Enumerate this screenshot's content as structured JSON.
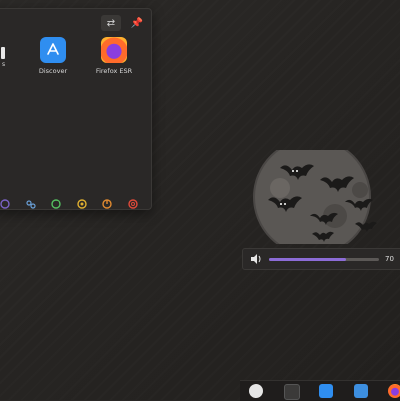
{
  "launcher": {
    "cut_app_label": "s",
    "apps": [
      {
        "label": "Discover",
        "icon": "discover-icon"
      },
      {
        "label": "Firefox ESR",
        "icon": "firefox-icon"
      }
    ],
    "header_icons": [
      "config-icon",
      "pin-icon"
    ],
    "session_icons": [
      "lock-icon",
      "switch-user-icon",
      "sleep-icon",
      "hibernate-icon",
      "shutdown-icon",
      "restart-icon"
    ]
  },
  "wallpaper": {
    "theme": "moon-with-bats"
  },
  "volume": {
    "level_percent": 70,
    "text": "70"
  },
  "taskbar": {
    "items": [
      "system-settings-icon",
      "terminal-icon",
      "discover-icon",
      "file-manager-icon",
      "firefox-icon"
    ]
  },
  "colors": {
    "accent": "#8c6cd6",
    "discover": "#2f8ef0"
  }
}
